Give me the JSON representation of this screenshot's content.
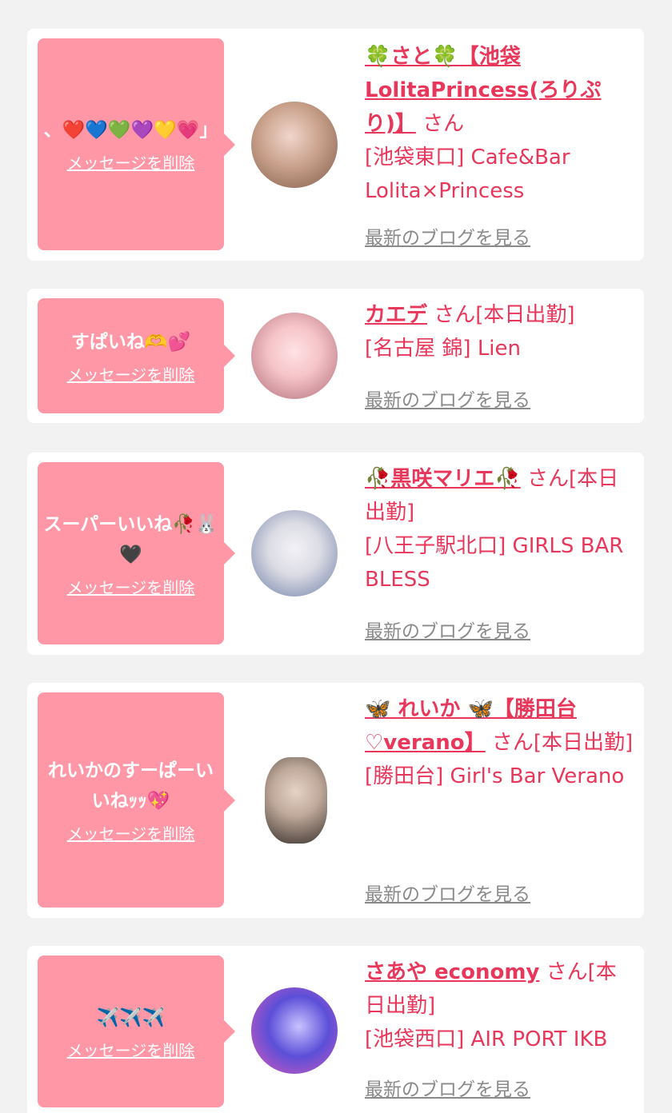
{
  "cards": [
    {
      "message": "、❤️💙💚💜💛💗」",
      "delete_label": "メッセージを削除",
      "name": "🍀さと🍀【池袋LolitaPrincess(ろりぷり)】",
      "suffix": "さん",
      "shop": "[池袋東口] Cafe&Bar Lolita×Princess",
      "blog_label": "最新のブログを見る",
      "avatar_colors": [
        "#c8a08a",
        "#7d5a48"
      ]
    },
    {
      "message": "すぱいね🫶💕",
      "delete_label": "メッセージを削除",
      "name": "カエデ",
      "suffix": "さん[本日出勤]",
      "shop": "[名古屋 錦] Lien",
      "blog_label": "最新のブログを見る",
      "avatar_colors": [
        "#f5c4c8",
        "#b06a78"
      ]
    },
    {
      "message": "スーパーいいね🥀🐰🖤",
      "delete_label": "メッセージを削除",
      "name": "🥀黒咲マリエ🥀",
      "suffix": "さん[本日出勤]",
      "shop": "[八王子駅北口] GIRLS BAR BLESS",
      "blog_label": "最新のブログを見る",
      "avatar_colors": [
        "#dcdce4",
        "#6d7ea8"
      ]
    },
    {
      "message": "れいかのすーぱーいいねｯｯ💖",
      "delete_label": "メッセージを削除",
      "name": "🦋 れいか 🦋【勝田台♡verano】",
      "suffix": "さん[本日出勤]",
      "shop": "[勝田台] Girl's Bar Verano",
      "blog_label": "最新のブログを見る",
      "avatar_colors": [
        "#bfa99a",
        "#3d3430"
      ]
    },
    {
      "message": "✈️✈️✈️",
      "delete_label": "メッセージを削除",
      "name": "さあや economy",
      "suffix": "さん[本日出勤]",
      "shop": "[池袋西口] AIR PORT IKB",
      "blog_label": "最新のブログを見る",
      "avatar_colors": [
        "#5b4fd8",
        "#e05ab8"
      ]
    }
  ]
}
